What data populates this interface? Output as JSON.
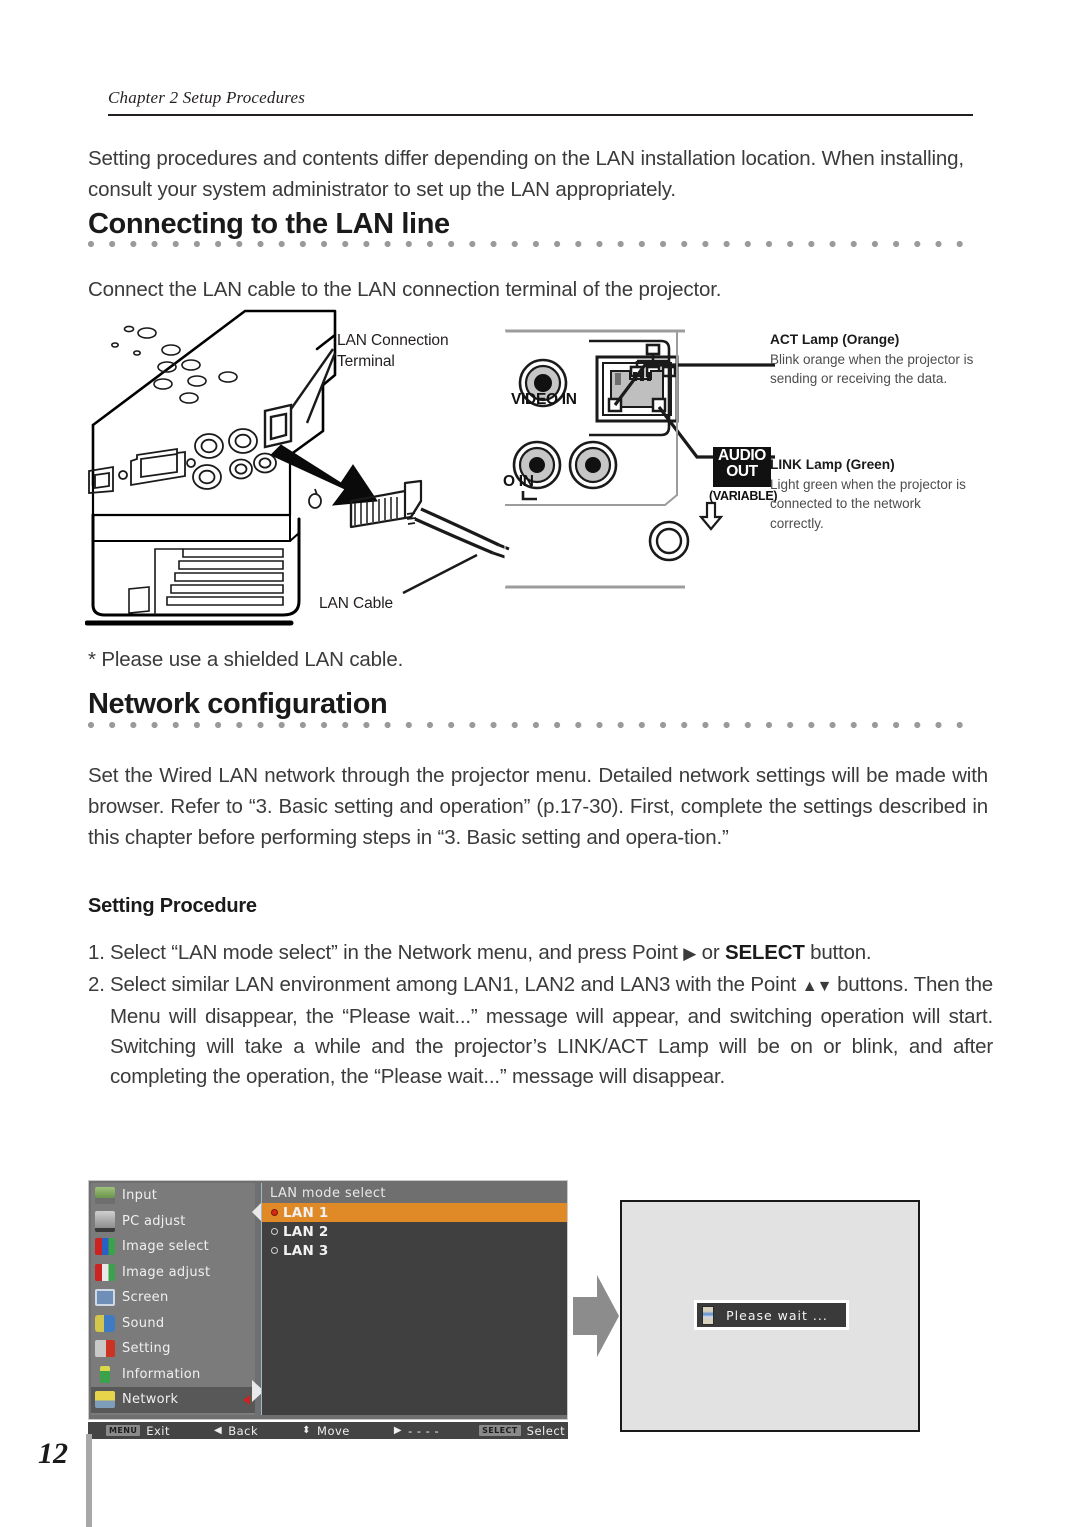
{
  "header": {
    "running_head": "Chapter 2 Setup Procedures"
  },
  "intro": "Setting procedures and contents differ depending on the LAN installation location. When installing, consult your system administrator to set up the LAN appropriately.",
  "sections": {
    "lan_line": {
      "heading": "Connecting to the LAN line",
      "lead": "Connect the LAN cable to the LAN connection terminal of the projector.",
      "footnote": "* Please use a shielded LAN cable."
    },
    "network_config": {
      "heading": "Network configuration",
      "body": "Set the Wired LAN network through the projector menu. Detailed network settings will be made with browser. Refer to “3. Basic setting and operation” (p.17-30). First, complete the settings described in this chapter before performing steps in “3. Basic setting and opera-tion.”",
      "subheading": "Setting Procedure",
      "steps": [
        {
          "num": "1.",
          "text_a": "Select “LAN mode select” in the Network menu, and press Point ",
          "glyph_a": "▶",
          "text_b": " or ",
          "bold": "SELECT",
          "text_c": " button."
        },
        {
          "num": "2.",
          "text_a": "Select similar LAN environment among LAN1, LAN2 and LAN3 with the Point ",
          "glyph_a": "▲▼",
          "text_b": " buttons. Then the Menu will disappear, the “Please wait...” message will appear, and switching operation will start. Switching will take a while and the projector’s LINK/ACT Lamp will be on or blink, and after completing the operation, the “Please wait...” message will disappear."
        }
      ]
    }
  },
  "figure": {
    "labels": {
      "lan_terminal": "LAN Connection Terminal",
      "lan_cable": "LAN Cable"
    },
    "panel_texts": {
      "video_in": "VIDEO IN",
      "audio_in": "O IN",
      "audio_out_line1": "AUDIO",
      "audio_out_line2": "OUT",
      "variable": "(VARIABLE)"
    },
    "notes": [
      {
        "title": "ACT Lamp (Orange)",
        "body": "Blink orange when the projector is sending or receiving the data."
      },
      {
        "title": "LINK Lamp (Green)",
        "body": "Light green when the projector is connected to the network correctly."
      }
    ]
  },
  "osd": {
    "menu_items": [
      {
        "label": "Input",
        "icon": "input-icon",
        "selected": false
      },
      {
        "label": "PC adjust",
        "icon": "pc-adjust-icon",
        "selected": false
      },
      {
        "label": "Image select",
        "icon": "image-select-icon",
        "selected": false
      },
      {
        "label": "Image adjust",
        "icon": "image-adjust-icon",
        "selected": false
      },
      {
        "label": "Screen",
        "icon": "screen-icon",
        "selected": false
      },
      {
        "label": "Sound",
        "icon": "sound-icon",
        "selected": false
      },
      {
        "label": "Setting",
        "icon": "setting-icon",
        "selected": false
      },
      {
        "label": "Information",
        "icon": "information-icon",
        "selected": false
      },
      {
        "label": "Network",
        "icon": "network-icon",
        "selected": true
      }
    ],
    "panel_title": "LAN mode select",
    "lan_options": [
      {
        "label": "LAN 1",
        "selected": true
      },
      {
        "label": "LAN 2",
        "selected": false
      },
      {
        "label": "LAN 3",
        "selected": false
      }
    ],
    "bottom_bar": [
      {
        "key": "MENU",
        "glyph": "",
        "label": "Exit"
      },
      {
        "key": "",
        "glyph": "◀",
        "label": "Back"
      },
      {
        "key": "",
        "glyph": "⬍",
        "label": "Move"
      },
      {
        "key": "",
        "glyph": "▶",
        "label": "- - - -"
      },
      {
        "key": "SELECT",
        "glyph": "",
        "label": "Select"
      }
    ],
    "highlight_color": "#e08a27",
    "selected_row_color": "#585858"
  },
  "wait_screen": {
    "message": "Please wait ..."
  },
  "folio": {
    "page_number": "12"
  }
}
